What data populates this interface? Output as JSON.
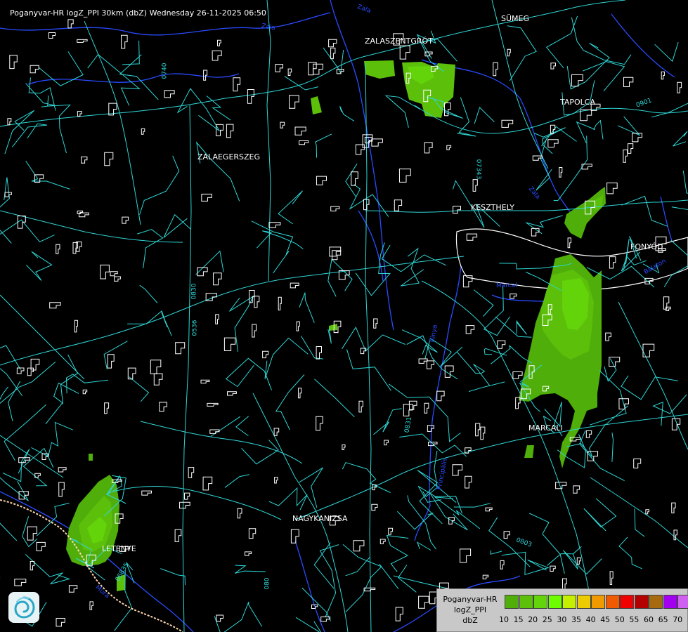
{
  "header": {
    "title": "Poganyvar-HR logZ_PPI 30km (dbZ) Wednesday 26-11-2025 06:50"
  },
  "cities": [
    {
      "name": "SÜMEG",
      "id": "sumeg"
    },
    {
      "name": "ZALASZENTGRÓT",
      "id": "zalaszentgrot"
    },
    {
      "name": "TAPOLCA",
      "id": "tapolca"
    },
    {
      "name": "ZALAEGERSZEG",
      "id": "zalaegerszeg"
    },
    {
      "name": "KESZTHELY",
      "id": "keszthely"
    },
    {
      "name": "FONYÓD",
      "id": "fonyod"
    },
    {
      "name": "MARCALI",
      "id": "marcali"
    },
    {
      "name": "NAGYKANIZSA",
      "id": "nagykanizsa"
    },
    {
      "name": "LETENYE",
      "id": "letenye"
    }
  ],
  "road_labels": [
    "0740",
    "07343",
    "0830",
    "0831",
    "0803",
    "06835",
    "0901",
    "080",
    "0536"
  ],
  "river_labels": [
    "Zala",
    "Zala",
    "Principális",
    "Rinya",
    "Mura",
    "Balaton",
    "Zala",
    "Marcal"
  ],
  "legend": {
    "line1": "Poganyvar-HR",
    "line2": "logZ_PPI",
    "line3": "dbZ",
    "colors": [
      "#4fae0a",
      "#5cc00a",
      "#63d30a",
      "#6dfc00",
      "#c4f000",
      "#eccb00",
      "#f09a00",
      "#f05a00",
      "#f00000",
      "#b40000",
      "#a86a10",
      "#a400f0",
      "#d060f0",
      "#b4b4ff"
    ],
    "ticks": [
      "10",
      "15",
      "20",
      "25",
      "30",
      "35",
      "40",
      "45",
      "50",
      "55",
      "60",
      "65",
      "70"
    ]
  },
  "colors": {
    "roads": "#2fd6d6",
    "rivers": "#2a4bff",
    "borders": "#ffffff",
    "echo_light": "#4fae0a",
    "echo_mid": "#5cc00a",
    "echo_bright": "#63d30a"
  }
}
